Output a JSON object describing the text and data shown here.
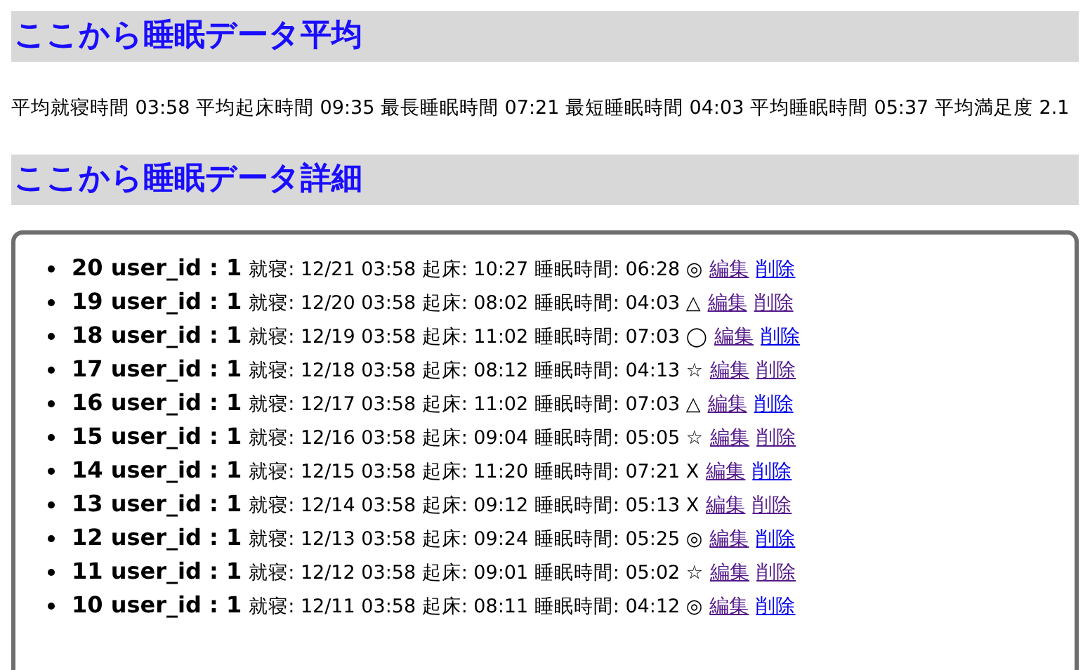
{
  "average_heading": "ここから睡眠データ平均",
  "average_summary": "平均就寝時間 03:58 平均起床時間 09:35 最長睡眠時間 07:21 最短睡眠時間 04:03 平均睡眠時間 05:37 平均満足度 2.1",
  "detail_heading": "ここから睡眠データ詳細",
  "records": [
    {
      "title": "20 user_id : 1",
      "details": "就寝: 12/21 03:58 起床: 10:27 睡眠時間: 06:28 ◎",
      "edit": {
        "label": "編集",
        "visited": true
      },
      "delete": {
        "label": "削除",
        "visited": false
      }
    },
    {
      "title": "19 user_id : 1",
      "details": "就寝: 12/20 03:58 起床: 08:02 睡眠時間: 04:03 △",
      "edit": {
        "label": "編集",
        "visited": true
      },
      "delete": {
        "label": "削除",
        "visited": true
      }
    },
    {
      "title": "18 user_id : 1",
      "details": "就寝: 12/19 03:58 起床: 11:02 睡眠時間: 07:03 ◯",
      "edit": {
        "label": "編集",
        "visited": true
      },
      "delete": {
        "label": "削除",
        "visited": false
      }
    },
    {
      "title": "17 user_id : 1",
      "details": "就寝: 12/18 03:58 起床: 08:12 睡眠時間: 04:13 ☆",
      "edit": {
        "label": "編集",
        "visited": true
      },
      "delete": {
        "label": "削除",
        "visited": true
      }
    },
    {
      "title": "16 user_id : 1",
      "details": "就寝: 12/17 03:58 起床: 11:02 睡眠時間: 07:03 △",
      "edit": {
        "label": "編集",
        "visited": true
      },
      "delete": {
        "label": "削除",
        "visited": false
      }
    },
    {
      "title": "15 user_id : 1",
      "details": "就寝: 12/16 03:58 起床: 09:04 睡眠時間: 05:05 ☆",
      "edit": {
        "label": "編集",
        "visited": true
      },
      "delete": {
        "label": "削除",
        "visited": true
      }
    },
    {
      "title": "14 user_id : 1",
      "details": "就寝: 12/15 03:58 起床: 11:20 睡眠時間: 07:21 X",
      "edit": {
        "label": "編集",
        "visited": true
      },
      "delete": {
        "label": "削除",
        "visited": false
      }
    },
    {
      "title": "13 user_id : 1",
      "details": "就寝: 12/14 03:58 起床: 09:12 睡眠時間: 05:13 X",
      "edit": {
        "label": "編集",
        "visited": true
      },
      "delete": {
        "label": "削除",
        "visited": true
      }
    },
    {
      "title": "12 user_id : 1",
      "details": "就寝: 12/13 03:58 起床: 09:24 睡眠時間: 05:25 ◎",
      "edit": {
        "label": "編集",
        "visited": true
      },
      "delete": {
        "label": "削除",
        "visited": false
      }
    },
    {
      "title": "11 user_id : 1",
      "details": "就寝: 12/12 03:58 起床: 09:01 睡眠時間: 05:02 ☆",
      "edit": {
        "label": "編集",
        "visited": true
      },
      "delete": {
        "label": "削除",
        "visited": true
      }
    },
    {
      "title": "10 user_id : 1",
      "details": "就寝: 12/11 03:58 起床: 08:11 睡眠時間: 04:12 ◎",
      "edit": {
        "label": "編集",
        "visited": true
      },
      "delete": {
        "label": "削除",
        "visited": false
      }
    }
  ]
}
